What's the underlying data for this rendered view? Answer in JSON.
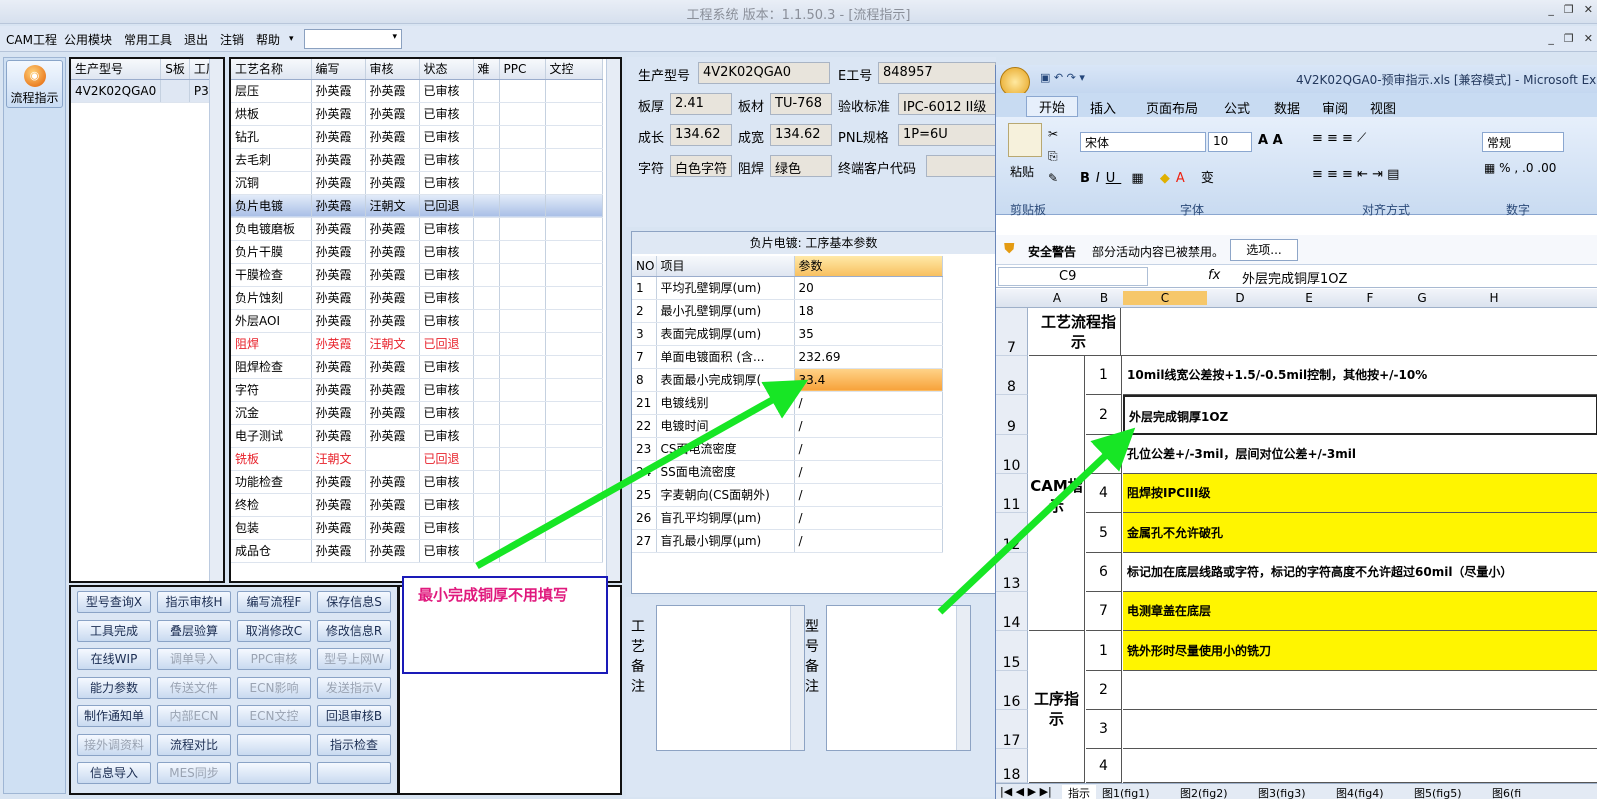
{
  "window": {
    "title": "工程系统  版本：1.1.50.3 - [流程指示]",
    "buttons": [
      "_",
      "❐",
      "✕"
    ]
  },
  "menu": {
    "items": [
      "CAM工程",
      "公用模块",
      "常用工具",
      "退出",
      "注销",
      "帮助"
    ],
    "dropdown_arrow": "▾",
    "mdi_buttons": [
      "_",
      "❐",
      "✕"
    ]
  },
  "nav": {
    "button_label": "流程指示"
  },
  "product_table": {
    "headers": [
      "生产型号",
      "S板",
      "工厂"
    ],
    "rows": [
      [
        "4V2K02QGA0",
        "",
        "P3"
      ]
    ]
  },
  "process_table": {
    "headers": [
      "工艺名称",
      "编写",
      "审核",
      "状态",
      "难",
      "PPC",
      "文控"
    ],
    "rows": [
      {
        "cells": [
          "层压",
          "孙英霞",
          "孙英霞",
          "已审核"
        ],
        "style": "normal"
      },
      {
        "cells": [
          "烘板",
          "孙英霞",
          "孙英霞",
          "已审核"
        ],
        "style": "normal"
      },
      {
        "cells": [
          "钻孔",
          "孙英霞",
          "孙英霞",
          "已审核"
        ],
        "style": "normal"
      },
      {
        "cells": [
          "去毛刺",
          "孙英霞",
          "孙英霞",
          "已审核"
        ],
        "style": "normal"
      },
      {
        "cells": [
          "沉铜",
          "孙英霞",
          "孙英霞",
          "已审核"
        ],
        "style": "normal"
      },
      {
        "cells": [
          "负片电镀",
          "孙英霞",
          "汪朝文",
          "已回退"
        ],
        "style": "selected"
      },
      {
        "cells": [
          "负电镀磨板",
          "孙英霞",
          "孙英霞",
          "已审核"
        ],
        "style": "normal"
      },
      {
        "cells": [
          "负片干膜",
          "孙英霞",
          "孙英霞",
          "已审核"
        ],
        "style": "normal"
      },
      {
        "cells": [
          "干膜检查",
          "孙英霞",
          "孙英霞",
          "已审核"
        ],
        "style": "normal"
      },
      {
        "cells": [
          "负片蚀刻",
          "孙英霞",
          "孙英霞",
          "已审核"
        ],
        "style": "normal"
      },
      {
        "cells": [
          "外层AOI",
          "孙英霞",
          "孙英霞",
          "已审核"
        ],
        "style": "normal"
      },
      {
        "cells": [
          "阻焊",
          "孙英霞",
          "汪朝文",
          "已回退"
        ],
        "style": "red"
      },
      {
        "cells": [
          "阻焊检查",
          "孙英霞",
          "孙英霞",
          "已审核"
        ],
        "style": "normal"
      },
      {
        "cells": [
          "字符",
          "孙英霞",
          "孙英霞",
          "已审核"
        ],
        "style": "normal"
      },
      {
        "cells": [
          "沉金",
          "孙英霞",
          "孙英霞",
          "已审核"
        ],
        "style": "normal"
      },
      {
        "cells": [
          "电子测试",
          "孙英霞",
          "孙英霞",
          "已审核"
        ],
        "style": "normal"
      },
      {
        "cells": [
          "铣板",
          "汪朝文",
          "",
          "已回退"
        ],
        "style": "red"
      },
      {
        "cells": [
          "功能检查",
          "孙英霞",
          "孙英霞",
          "已审核"
        ],
        "style": "normal"
      },
      {
        "cells": [
          "终检",
          "孙英霞",
          "孙英霞",
          "已审核"
        ],
        "style": "normal"
      },
      {
        "cells": [
          "包装",
          "孙英霞",
          "孙英霞",
          "已审核"
        ],
        "style": "normal"
      },
      {
        "cells": [
          "成品仓",
          "孙英霞",
          "孙英霞",
          "已审核"
        ],
        "style": "normal"
      }
    ]
  },
  "buttons": [
    [
      {
        "label": "型号查询X",
        "enabled": true
      },
      {
        "label": "指示审核H",
        "enabled": true
      },
      {
        "label": "编写流程F",
        "enabled": true
      },
      {
        "label": "保存信息S",
        "enabled": true
      }
    ],
    [
      {
        "label": "工具完成",
        "enabled": true
      },
      {
        "label": "叠层验算",
        "enabled": true
      },
      {
        "label": "取消修改C",
        "enabled": true
      },
      {
        "label": "修改信息R",
        "enabled": true
      }
    ],
    [
      {
        "label": "在线WIP",
        "enabled": true
      },
      {
        "label": "调单导入",
        "enabled": false
      },
      {
        "label": "PPC审核",
        "enabled": false
      },
      {
        "label": "型号上网W",
        "enabled": false
      }
    ],
    [
      {
        "label": "能力参数",
        "enabled": true
      },
      {
        "label": "传送文件",
        "enabled": false
      },
      {
        "label": "ECN影响",
        "enabled": false
      },
      {
        "label": "发送指示V",
        "enabled": false
      }
    ],
    [
      {
        "label": "制作通知单",
        "enabled": true
      },
      {
        "label": "内部ECN",
        "enabled": false
      },
      {
        "label": "ECN文控",
        "enabled": false
      },
      {
        "label": "回退审核B",
        "enabled": true
      }
    ],
    [
      {
        "label": "接外调资料",
        "enabled": false
      },
      {
        "label": "流程对比",
        "enabled": true
      },
      {
        "label": "",
        "enabled": true
      },
      {
        "label": "指示检查",
        "enabled": true
      }
    ],
    [
      {
        "label": "信息导入",
        "enabled": true
      },
      {
        "label": "MES同步",
        "enabled": false
      },
      {
        "label": "",
        "enabled": true
      },
      {
        "label": "",
        "enabled": true
      }
    ]
  ],
  "annotation": {
    "text": "最小完成铜厚不用填写",
    "color": "#e0197d",
    "arrow_color": "#17e625"
  },
  "info": {
    "prod_label": "生产型号",
    "prod_value": "4V2K02QGA0",
    "e_label": "E工号",
    "e_value": "848957",
    "thick_label": "板厚",
    "thick_value": "2.41",
    "mat_label": "板材",
    "mat_value": "TU-768",
    "std_label": "验收标准",
    "std_value": "IPC-6012 II级",
    "len_label": "成长",
    "len_value": "134.62",
    "wid_label": "成宽",
    "wid_value": "134.62",
    "pnl_label": "PNL规格",
    "pnl_value": "1P=6U",
    "char_label": "字符",
    "char_value": "白色字符",
    "mask_label": "阻焊",
    "mask_value": "绿色",
    "cust_label": "终端客户代码",
    "cust_value": ""
  },
  "params": {
    "title": "负片电镀: 工序基本参数",
    "headers": [
      "NO",
      "项目",
      "参数"
    ],
    "rows": [
      [
        "1",
        "平均孔壁铜厚(um)",
        "20"
      ],
      [
        "2",
        "最小孔壁铜厚(um)",
        "18"
      ],
      [
        "3",
        "表面完成铜厚(um)",
        "35"
      ],
      [
        "7",
        "单面电镀面积 (含...",
        "232.69"
      ],
      [
        "8",
        "表面最小完成铜厚(...",
        "33.4"
      ],
      [
        "21",
        "电镀线别",
        "/"
      ],
      [
        "22",
        "电镀时间",
        "/"
      ],
      [
        "23",
        "CS面电流密度",
        "/"
      ],
      [
        "24",
        "SS面电流密度",
        "/"
      ],
      [
        "25",
        "字麦朝向(CS面朝外)",
        "/"
      ],
      [
        "26",
        "盲孔平均铜厚(μm)",
        "/"
      ],
      [
        "27",
        "盲孔最小铜厚(μm)",
        "/"
      ]
    ],
    "highlight_row": 4
  },
  "remarks": {
    "left_label": "工艺备注",
    "right_label": "型号备注",
    "left_text": "",
    "right_text": ""
  },
  "excel": {
    "title": "4V2K02QGA0-预审指示.xls  [兼容模式] - Microsoft Ex",
    "tabs": [
      "开始",
      "插入",
      "页面布局",
      "公式",
      "数据",
      "审阅",
      "视图"
    ],
    "groups": [
      "剪贴板",
      "字体",
      "对齐方式",
      "数字"
    ],
    "paste_label": "粘贴",
    "font_name": "宋体",
    "font_size": "10",
    "number_format": "常规",
    "security_warning": "安全警告",
    "security_text": "部分活动内容已被禁用。",
    "options_button": "选项...",
    "name_box": "C9",
    "fx": "fx",
    "formula": "外层完成铜厚1OZ",
    "col_headers": [
      "A",
      "B",
      "C",
      "D",
      "E",
      "F",
      "G",
      "H"
    ],
    "rows": [
      {
        "rownum": "7",
        "b": "",
        "c": "",
        "yellow": false
      },
      {
        "rownum": "8",
        "b": "1",
        "c": "10mil线宽公差按+1.5/-0.5mil控制，其他按+/-10%",
        "yellow": false
      },
      {
        "rownum": "9",
        "b": "2",
        "c": "外层完成铜厚1OZ",
        "yellow": false
      },
      {
        "rownum": "10",
        "b": "3",
        "c": "孔位公差+/-3mil，层间对位公差+/-3mil",
        "yellow": false
      },
      {
        "rownum": "11",
        "b": "4",
        "c": "阻焊按IPCIII级",
        "yellow": true
      },
      {
        "rownum": "12",
        "b": "5",
        "c": "金属孔不允许破孔",
        "yellow": true
      },
      {
        "rownum": "13",
        "b": "6",
        "c": "标记加在底层线路或字符，标记的字符高度不允许超过60mil（尽量小）",
        "yellow": false
      },
      {
        "rownum": "14",
        "b": "7",
        "c": "电测章盖在底层",
        "yellow": true
      },
      {
        "rownum": "15",
        "b": "1",
        "c": "铣外形时尽量使用小的铣刀",
        "yellow": true
      },
      {
        "rownum": "16",
        "b": "2",
        "c": "",
        "yellow": false
      },
      {
        "rownum": "17",
        "b": "3",
        "c": "",
        "yellow": false
      },
      {
        "rownum": "18",
        "b": "4",
        "c": "",
        "yellow": false
      }
    ],
    "section_labels": [
      "工艺流程指示",
      "CAM指示",
      "工序指示"
    ],
    "sheets": [
      "指示",
      "图1(fig1)",
      "图2(fig2)",
      "图3(fig3)",
      "图4(fig4)",
      "图5(fig5)",
      "图6(fi"
    ]
  }
}
